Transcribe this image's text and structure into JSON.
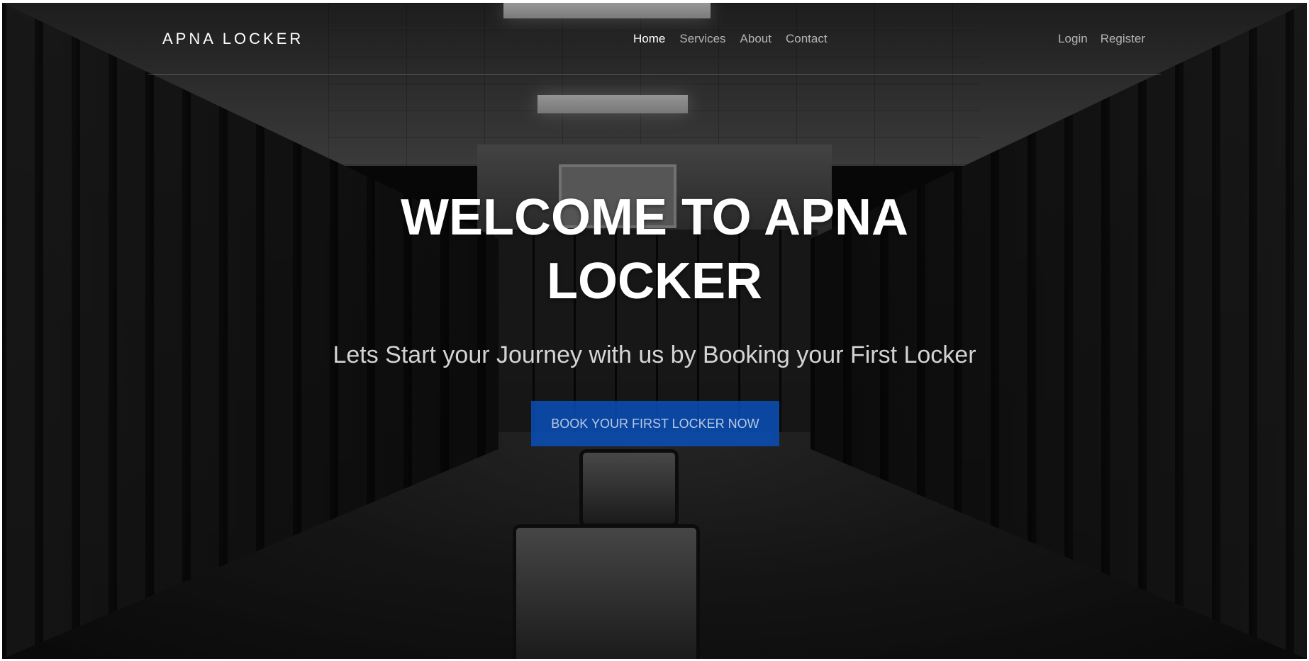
{
  "navbar": {
    "brand": "APNA LOCKER",
    "links": [
      {
        "label": "Home",
        "active": true
      },
      {
        "label": "Services",
        "active": false
      },
      {
        "label": "About",
        "active": false
      },
      {
        "label": "Contact",
        "active": false
      }
    ],
    "auth": {
      "login": "Login",
      "register": "Register"
    }
  },
  "hero": {
    "title_line1": "WELCOME TO APNA",
    "title_line2": "LOCKER",
    "subtitle": "Lets Start your Journey with us by Booking your First Locker",
    "cta_label": "BOOK YOUR FIRST LOCKER NOW",
    "background": "locker-room-photo"
  },
  "colors": {
    "cta": "#0850be",
    "text": "#ffffff"
  }
}
